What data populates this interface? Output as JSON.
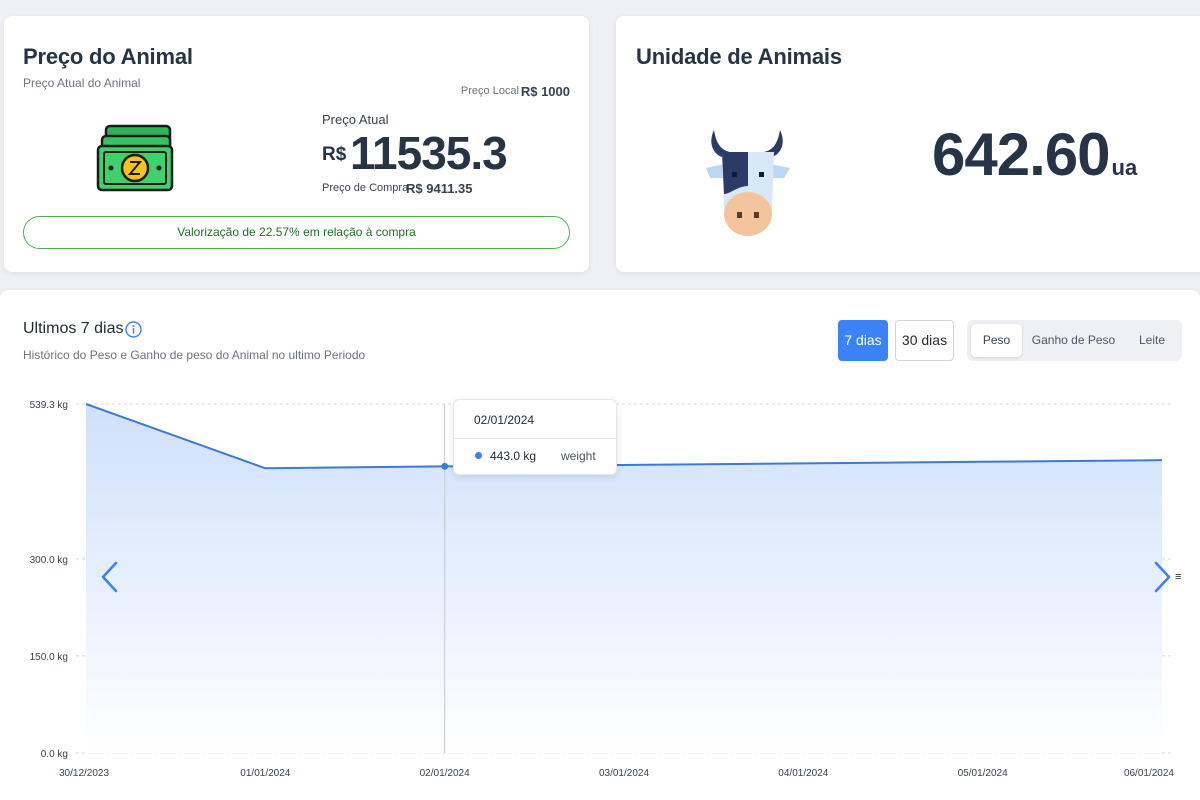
{
  "price_card": {
    "title": "Preço do Animal",
    "subtitle": "Preço Atual do Animal",
    "local_label": "Preço Local",
    "local_value": "R$ 1000",
    "current_label": "Preço Atual",
    "currency_symbol": "R$",
    "current_value": "11535.3",
    "purchase_label": "Preço de Compra",
    "purchase_value": "R$ 9411.35",
    "valorization": "Valorização de 22.57% em relação à compra",
    "icon": "money-bills-icon"
  },
  "units_card": {
    "title": "Unidade de Animais",
    "value": "642.60",
    "unit": "ua",
    "icon": "cow-icon"
  },
  "chart_card": {
    "title": "Ultimos 7 dias",
    "subtitle": "Histórico do Peso e Ganho de peso do Animal no ultimo Periodo",
    "period_buttons": [
      "7 dias",
      "30 dias"
    ],
    "active_period": "7 dias",
    "metric_tabs": [
      "Peso",
      "Ganho de Peso",
      "Leite"
    ],
    "active_metric": "Peso",
    "tooltip": {
      "date": "02/01/2024",
      "value": "443.0 kg",
      "series": "weight"
    },
    "menu_glyph": "≡",
    "colors": {
      "accent": "#3b82f6",
      "line": "#3a7bd5",
      "area_top": "#cfe0fb",
      "area_bottom": "#ffffff",
      "positive": "#4caf50"
    }
  },
  "chart_data": {
    "type": "area",
    "x": [
      "30/12/2023",
      "01/01/2024",
      "02/01/2024",
      "03/01/2024",
      "04/01/2024",
      "05/01/2024",
      "06/01/2024"
    ],
    "series": [
      {
        "name": "weight",
        "values": [
          539.3,
          440.0,
          443.0,
          445.0,
          447.5,
          450.0,
          452.5
        ]
      }
    ],
    "y_ticks": [
      "0.0 kg",
      "150.0 kg",
      "300.0 kg",
      "539.3 kg"
    ],
    "y_tick_values": [
      0,
      150,
      300,
      539.3
    ],
    "ylim": [
      0,
      539.3
    ],
    "grid": true,
    "highlight_index": 2
  }
}
